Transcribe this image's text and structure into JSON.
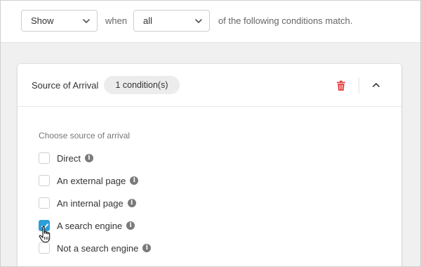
{
  "condition_bar": {
    "action_select": "Show",
    "when_text": "when",
    "match_select": "all",
    "tail_text": "of the following conditions match."
  },
  "card": {
    "title": "Source of Arrival",
    "badge": "1 condition(s)",
    "section_label": "Choose source of arrival",
    "options": [
      {
        "label": "Direct",
        "checked": false
      },
      {
        "label": "An external page",
        "checked": false
      },
      {
        "label": "An internal page",
        "checked": false
      },
      {
        "label": "A search engine",
        "checked": true
      },
      {
        "label": "Not a search engine",
        "checked": false
      }
    ]
  },
  "icons": {
    "delete": "trash-icon",
    "collapse": "chevron-up-icon",
    "info": "info-icon",
    "cursor": "hand-pointer-icon"
  },
  "colors": {
    "accent": "#2b9fd9",
    "danger": "#e5484d"
  }
}
